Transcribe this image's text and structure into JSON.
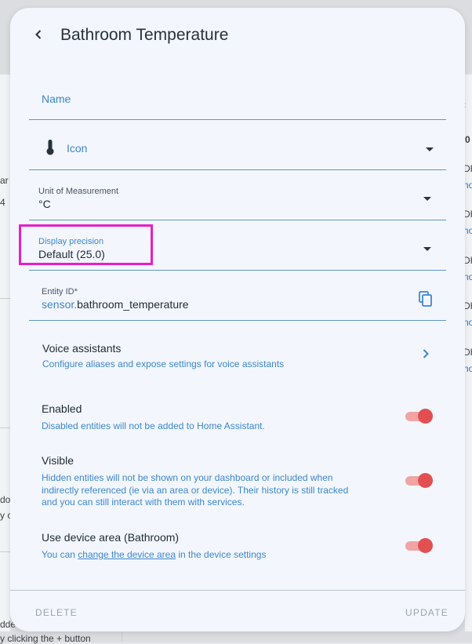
{
  "background": {
    "left_fragments": [
      "ar",
      "4",
      "do",
      "y c"
    ],
    "bottom_fragments": [
      "dde",
      "y clicking the + button"
    ],
    "right_fragments": [
      "0",
      "DH",
      "no",
      "DH",
      "no",
      "DH",
      "no",
      "DH",
      "no",
      "DH",
      "no"
    ]
  },
  "dialog": {
    "title": "Bathroom Temperature",
    "name_field": {
      "label": "Name",
      "value": ""
    },
    "icon_field": {
      "label": "Icon",
      "icon": "thermometer-icon"
    },
    "unit_field": {
      "label": "Unit of Measurement",
      "value": "°C"
    },
    "precision_field": {
      "label": "Display precision",
      "value": "Default (25.0)"
    },
    "entity_id_field": {
      "label": "Entity ID*",
      "prefix": "sensor.",
      "value": "bathroom_temperature"
    },
    "voice": {
      "title": "Voice assistants",
      "subtitle": "Configure aliases and expose settings for voice assistants"
    },
    "enabled": {
      "title": "Enabled",
      "subtitle": "Disabled entities will not be added to Home Assistant.",
      "on": true
    },
    "visible": {
      "title": "Visible",
      "subtitle_line1": "Hidden entities will not be shown on your dashboard or included when",
      "subtitle_line2": "indirectly referenced (ie via an area or device). Their history is still tracked",
      "subtitle_line3": "and you can still interact with them with services.",
      "on": true
    },
    "device_area": {
      "title": "Use device area (Bathroom)",
      "subtitle_prefix": "You can ",
      "subtitle_link": "change the device area",
      "subtitle_suffix": " in the device settings",
      "on": true
    },
    "footer": {
      "delete_label": "DELETE",
      "update_label": "UPDATE"
    }
  },
  "colors": {
    "accent": "#3d86cf",
    "toggle_on": "#e34f51",
    "highlight": "#e81ec8"
  }
}
